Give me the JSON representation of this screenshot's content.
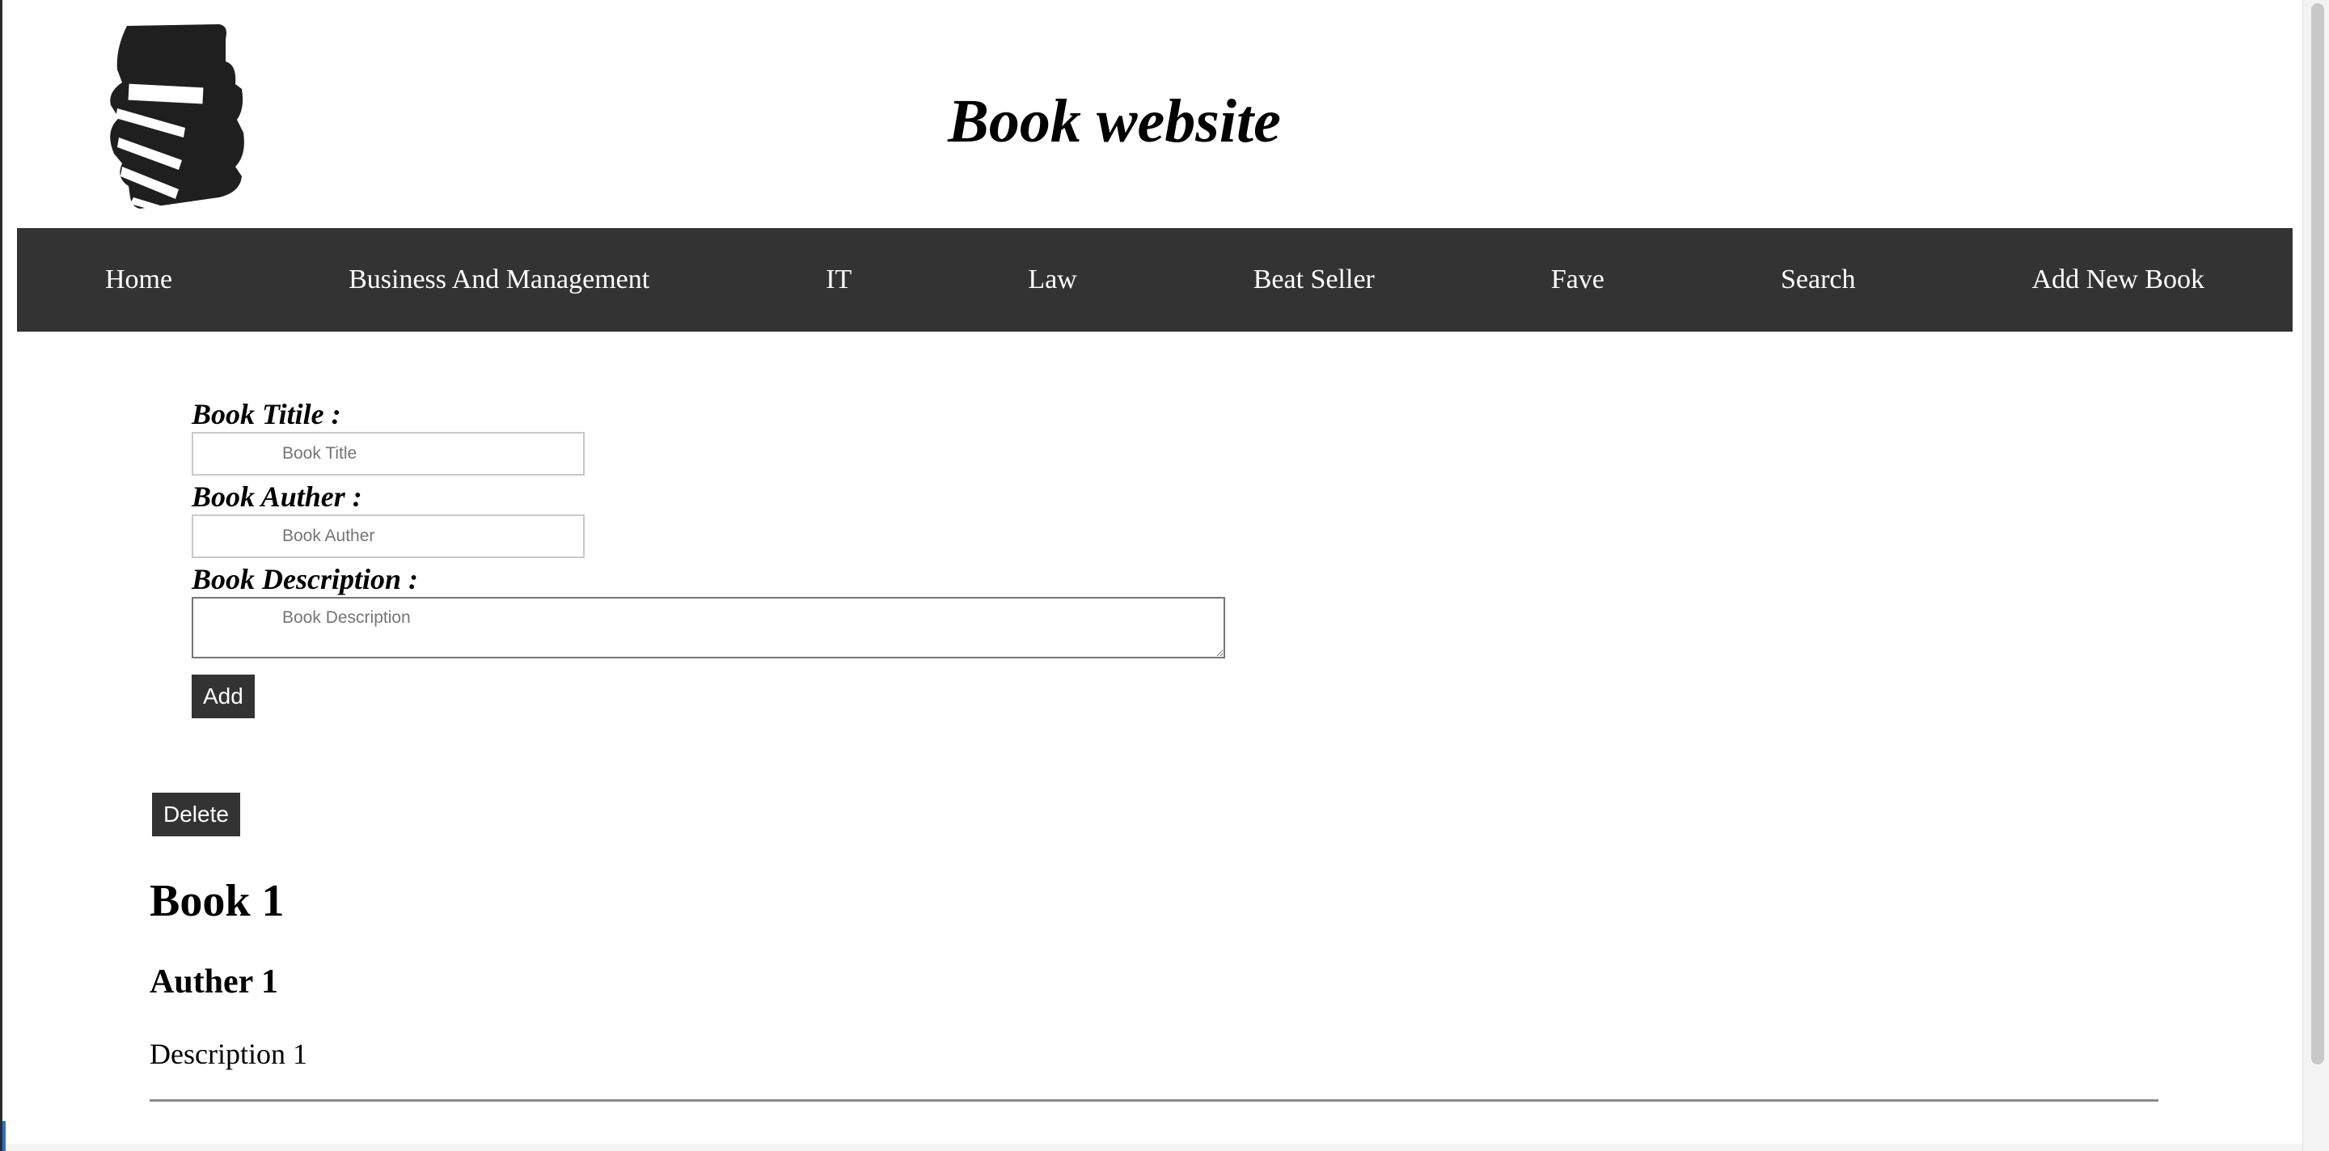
{
  "header": {
    "title": "Book website",
    "logo_icon": "book-stack-icon"
  },
  "nav": {
    "items": [
      {
        "label": "Home"
      },
      {
        "label": "Business And Management"
      },
      {
        "label": "IT"
      },
      {
        "label": "Law"
      },
      {
        "label": "Beat Seller"
      },
      {
        "label": "Fave"
      },
      {
        "label": "Search"
      },
      {
        "label": "Add New Book"
      }
    ]
  },
  "form": {
    "title_label": "Book Titile :",
    "title_placeholder": "Book Title",
    "title_value": "",
    "author_label": "Book Auther :",
    "author_placeholder": "Book Auther",
    "author_value": "",
    "description_label": "Book Description :",
    "description_placeholder": "Book Description",
    "description_value": "",
    "add_button": "Add"
  },
  "books": [
    {
      "delete_button": "Delete",
      "title": "Book 1",
      "author": "Auther 1",
      "description": "Description 1"
    }
  ],
  "colors": {
    "nav_background": "#333333",
    "button_background": "#333333",
    "text": "#000000"
  }
}
